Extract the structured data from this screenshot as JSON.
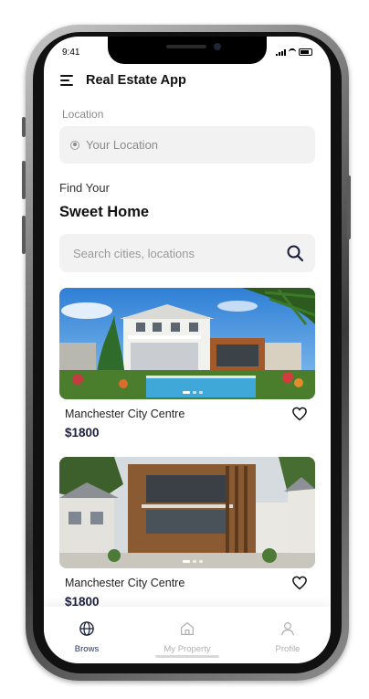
{
  "status_bar": {
    "time": "9:41"
  },
  "header": {
    "title": "Real Estate App",
    "menu_icon": "hamburger-menu-icon"
  },
  "location": {
    "label": "Location",
    "placeholder": "Your Location",
    "icon": "location-radio-icon"
  },
  "hero": {
    "line1": "Find Your",
    "line2": "Sweet Home"
  },
  "search": {
    "placeholder": "Search cities, locations",
    "icon": "search-icon"
  },
  "listings": [
    {
      "name": "Manchester City Centre",
      "price": "$1800",
      "image": "white-house-with-pool-photo",
      "favorite_icon": "heart-outline-icon"
    },
    {
      "name": "Manchester City Centre",
      "price": "$1800",
      "image": "modern-wood-house-photo",
      "favorite_icon": "heart-outline-icon"
    }
  ],
  "nav": [
    {
      "label": "Brows",
      "icon": "globe-icon",
      "active": true
    },
    {
      "label": "My Property",
      "icon": "home-icon",
      "active": false
    },
    {
      "label": "Profile",
      "icon": "user-icon",
      "active": false
    }
  ],
  "colors": {
    "accent": "#1a1f3c",
    "field_bg": "#f2f2f2",
    "muted_text": "#9a9a9a"
  }
}
